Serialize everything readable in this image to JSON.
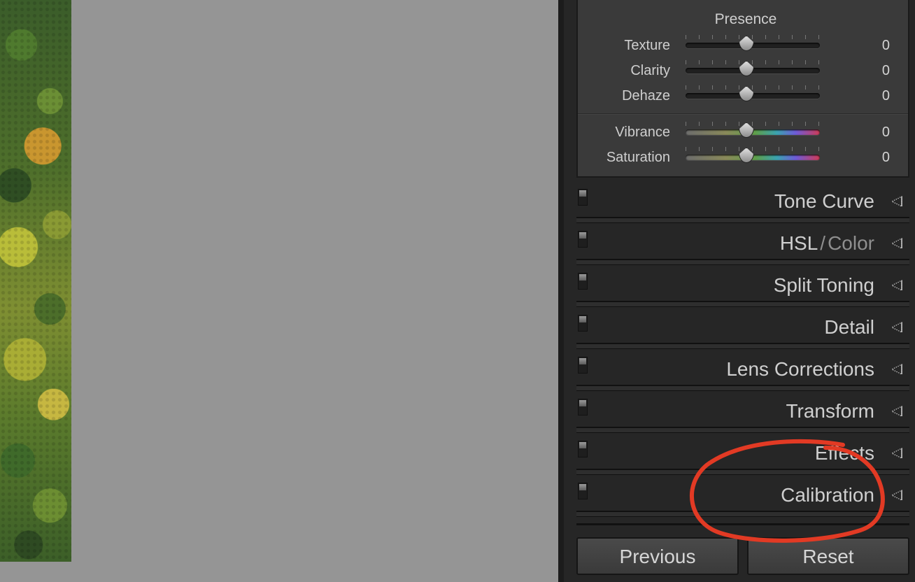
{
  "presence": {
    "title": "Presence",
    "sliders": [
      {
        "label": "Texture",
        "value": "0",
        "kind": "neutral"
      },
      {
        "label": "Clarity",
        "value": "0",
        "kind": "neutral"
      },
      {
        "label": "Dehaze",
        "value": "0",
        "kind": "neutral"
      },
      {
        "label": "Vibrance",
        "value": "0",
        "kind": "color"
      },
      {
        "label": "Saturation",
        "value": "0",
        "kind": "color"
      }
    ]
  },
  "sections": [
    {
      "label": "Tone Curve"
    },
    {
      "label": "HSL",
      "label_extra": "Color"
    },
    {
      "label": "Split Toning"
    },
    {
      "label": "Detail"
    },
    {
      "label": "Lens Corrections"
    },
    {
      "label": "Transform"
    },
    {
      "label": "Effects"
    },
    {
      "label": "Calibration"
    }
  ],
  "buttons": {
    "previous": "Previous",
    "reset": "Reset"
  },
  "colors": {
    "panel_bg": "#262626",
    "canvas_bg": "#959595",
    "annotation": "#e23a24"
  },
  "icons": {
    "section_toggle": "toggle-switch-icon",
    "section_expand": "triangle-expand-icon"
  }
}
